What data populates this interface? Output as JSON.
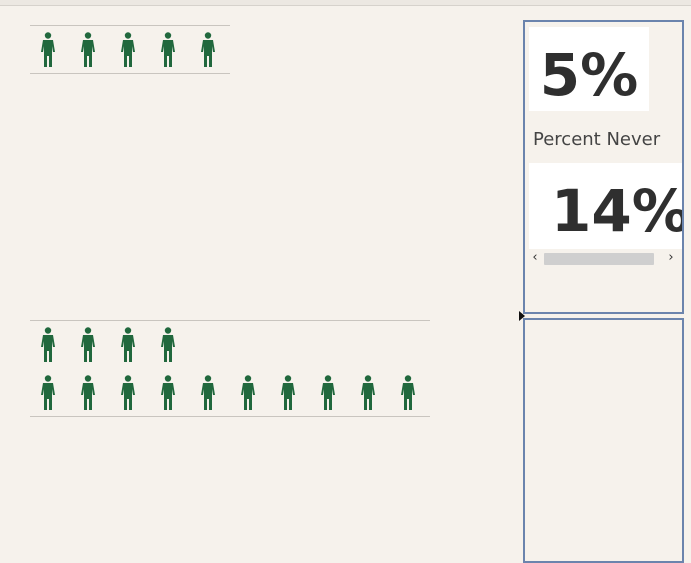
{
  "colors": {
    "background": "#f6f2ec",
    "person_icon": "#21683d",
    "panel_border": "#6b84ad"
  },
  "icon_name": "person-icon",
  "groups": [
    {
      "rows": [
        {
          "count": 5
        }
      ]
    },
    {
      "rows": [
        {
          "count": 4
        },
        {
          "count": 10
        }
      ]
    }
  ],
  "kpi_panel": {
    "kpi_top_value": "5%",
    "label": "Percent Never",
    "kpi_bottom_value": "14%",
    "scroll_left": "‹",
    "scroll_right": "›"
  }
}
